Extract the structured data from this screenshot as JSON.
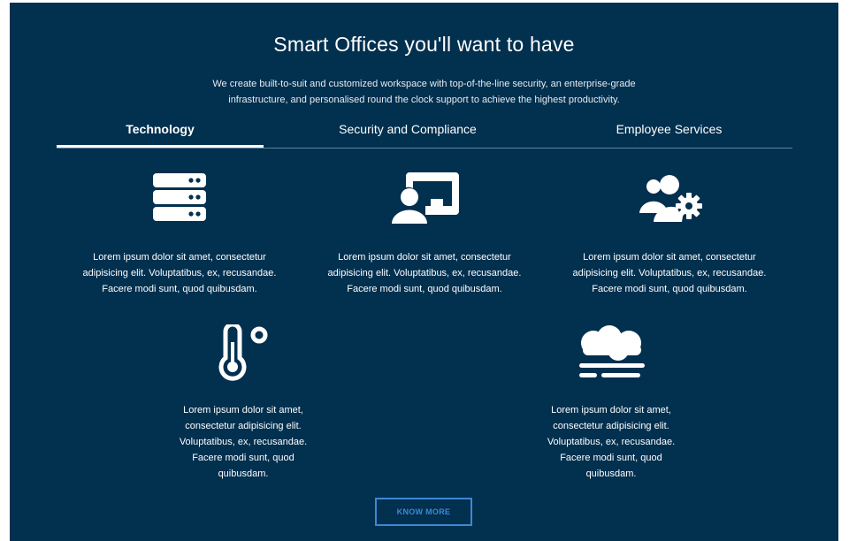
{
  "section": {
    "title": "Smart Offices you'll want to have",
    "subtitle": "We create built-to-suit and customized workspace with top-of-the-line security, an enterprise-grade infrastructure, and personalised round the clock support to achieve the highest productivity."
  },
  "tabs": [
    {
      "label": "Technology",
      "active": true
    },
    {
      "label": "Security and Compliance",
      "active": false
    },
    {
      "label": "Employee Services",
      "active": false
    }
  ],
  "features": [
    {
      "icon": "server-icon",
      "text": "Lorem ipsum dolor sit amet, consectetur adipisicing elit. Voluptatibus, ex, recusandae. Facere modi sunt, quod quibusdam."
    },
    {
      "icon": "presentation-user-icon",
      "text": "Lorem ipsum dolor sit amet, consectetur adipisicing elit. Voluptatibus, ex, recusandae. Facere modi sunt, quod quibusdam."
    },
    {
      "icon": "users-cog-icon",
      "text": "Lorem ipsum dolor sit amet, consectetur adipisicing elit. Voluptatibus, ex, recusandae. Facere modi sunt, quod quibusdam."
    },
    {
      "icon": "thermometer-icon",
      "text": "Lorem ipsum dolor sit amet, consectetur adipisicing elit. Voluptatibus, ex, recusandae. Facere modi sunt, quod quibusdam."
    },
    {
      "icon": "fog-cloud-icon",
      "text": "Lorem ipsum dolor sit amet, consectetur adipisicing elit. Voluptatibus, ex, recusandae. Facere modi sunt, quod quibusdam."
    }
  ],
  "cta": {
    "label": "KNOW MORE"
  },
  "colors": {
    "background": "#02304f",
    "accent": "#3e87d6",
    "text": "#ffffff"
  }
}
